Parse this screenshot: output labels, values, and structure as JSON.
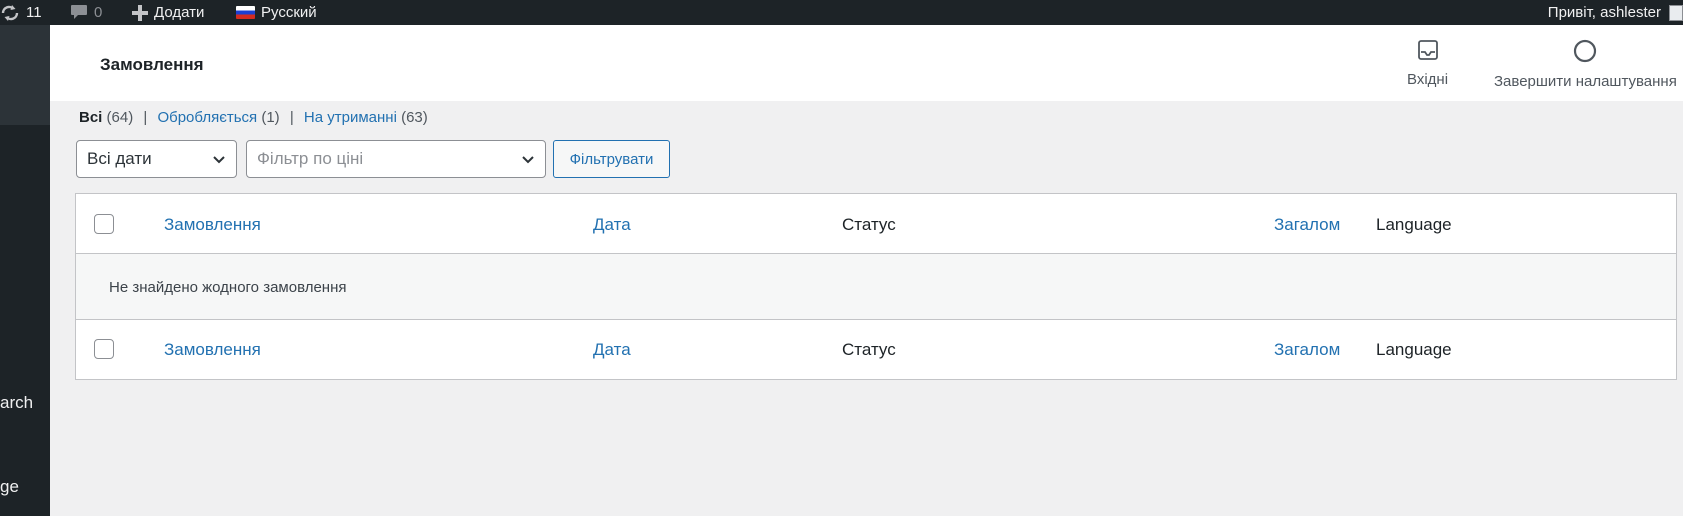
{
  "adminbar": {
    "updates_count": "11",
    "comments_count": "0",
    "add_new_label": "Додати",
    "language_label": "Русский",
    "greeting": "Привіт, ashlester"
  },
  "sidebar": {
    "fragments": [
      "arch",
      "ge"
    ]
  },
  "header": {
    "title": "Замовлення",
    "inbox_label": "Вхідні",
    "setup_label": "Завершити налаштування"
  },
  "views": {
    "all": {
      "label": "Всі",
      "count": "(64)"
    },
    "processing": {
      "label": "Обробляється",
      "count": "(1)"
    },
    "on_hold": {
      "label": "На утриманні",
      "count": "(63)"
    },
    "separator": "|"
  },
  "filters": {
    "date_selected": "Всі дати",
    "price_placeholder": "Фільтр по ціні",
    "filter_button": "Фільтрувати"
  },
  "table": {
    "columns": [
      "Замовлення",
      "Дата",
      "Статус",
      "Загалом",
      "Language"
    ],
    "empty_message": "Не знайдено жодного замовлення"
  },
  "colors": {
    "adminbar_bg": "#1d2327",
    "link": "#2271b1",
    "page_bg": "#f0f0f1"
  },
  "icons": {
    "updates": "refresh-icon",
    "comments": "comment-icon",
    "add": "plus-icon",
    "language": "russian-flag-icon",
    "inbox": "inbox-icon",
    "setup": "progress-circle-icon",
    "select": "chevron-down-icon"
  }
}
